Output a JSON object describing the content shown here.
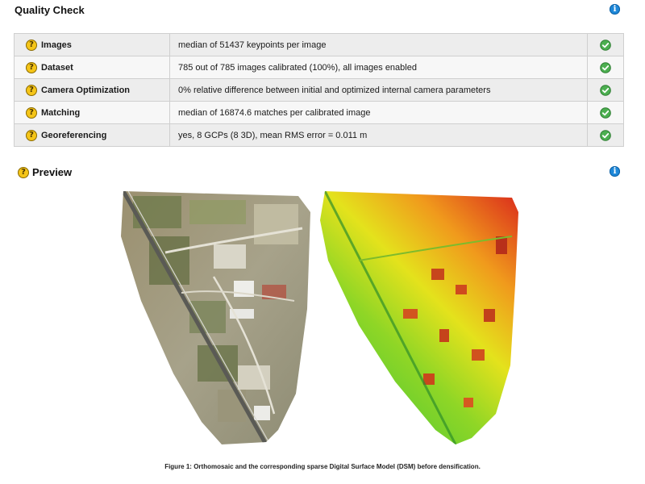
{
  "quality_check": {
    "title": "Quality Check",
    "rows": [
      {
        "name": "Images",
        "value": "median of 51437 keypoints per image",
        "status": "ok"
      },
      {
        "name": "Dataset",
        "value": "785 out of 785 images calibrated (100%), all images enabled",
        "status": "ok"
      },
      {
        "name": "Camera Optimization",
        "value": "0% relative difference between initial and optimized internal camera parameters",
        "status": "ok"
      },
      {
        "name": "Matching",
        "value": "median of 16874.6 matches per calibrated image",
        "status": "ok"
      },
      {
        "name": "Georeferencing",
        "value": "yes, 8 GCPs (8 3D), mean RMS error = 0.011 m",
        "status": "ok"
      }
    ]
  },
  "preview": {
    "title": "Preview",
    "caption": "Figure 1: Orthomosaic and the corresponding sparse Digital Surface Model (DSM) before densification."
  },
  "icons": {
    "info": "info-icon",
    "help": "question-icon",
    "status_ok": "check-circle-icon"
  },
  "colors": {
    "info_blue": "#1e88d9",
    "help_yellow": "#f5c518",
    "ok_green": "#4caf50"
  }
}
